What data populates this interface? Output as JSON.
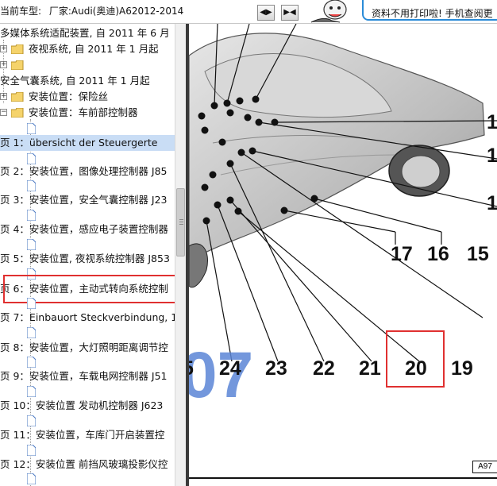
{
  "header": {
    "car_label": "当前车型:",
    "car_value": "厂家:Audi(奥迪)A62012-2014",
    "btn_expand_icon": "expand-icon",
    "btn_collapse_icon": "collapse-icon",
    "ad_text": "资料不用打印啦! 手机查阅更"
  },
  "tree": {
    "items": [
      {
        "label": "多媒体系统适配装置, 自 2011 年 6 月"
      },
      {
        "label": "夜视系统, 自 2011 年 1 月起"
      },
      {
        "label": ""
      },
      {
        "label": "安全气囊系统, 自 2011 年 1 月起"
      },
      {
        "label": "安装位置：保险丝"
      },
      {
        "label": "安装位置：车前部控制器"
      },
      {
        "label": ""
      },
      {
        "label": "页 1：übersicht der Steuergerte"
      },
      {
        "label": ""
      },
      {
        "label": "页 2：安装位置，图像处理控制器 J85"
      },
      {
        "label": ""
      },
      {
        "label": "页 3：安装位置，安全气囊控制器 J23"
      },
      {
        "label": ""
      },
      {
        "label": "页 4：安装位置，感应电子装置控制器"
      },
      {
        "label": ""
      },
      {
        "label": "页 5：安装位置, 夜视系统控制器 J853"
      },
      {
        "label": ""
      },
      {
        "label": "页 6：安装位置，主动式转向系统控制"
      },
      {
        "label": ""
      },
      {
        "label": "页 7：Einbauort Steckverbindung, 1"
      },
      {
        "label": ""
      },
      {
        "label": "页 8：安装位置，大灯照明距离调节控"
      },
      {
        "label": ""
      },
      {
        "label": "页 9：安装位置，车载电网控制器 J51"
      },
      {
        "label": ""
      },
      {
        "label": "页 10：安装位置 发动机控制器 J623"
      },
      {
        "label": ""
      },
      {
        "label": "页 11：安装位置，车库门开启装置控"
      },
      {
        "label": ""
      },
      {
        "label": "页 12：安装位置 前挡风玻璃投影仪控"
      },
      {
        "label": ""
      }
    ]
  },
  "diagram": {
    "callouts": [
      "17",
      "16",
      "15",
      "24",
      "23",
      "22",
      "21",
      "20",
      "19"
    ],
    "partial_callouts": [
      "1",
      "1",
      "1"
    ],
    "left_partial": "5",
    "page_ref": "A97",
    "watermark_text": "07",
    "highlight_callout": "20",
    "highlight_tree_item": "页 6：安装位置，主动式转向系统控制",
    "accent_color": "#e03030",
    "watermark_color": "#5b86d6"
  }
}
